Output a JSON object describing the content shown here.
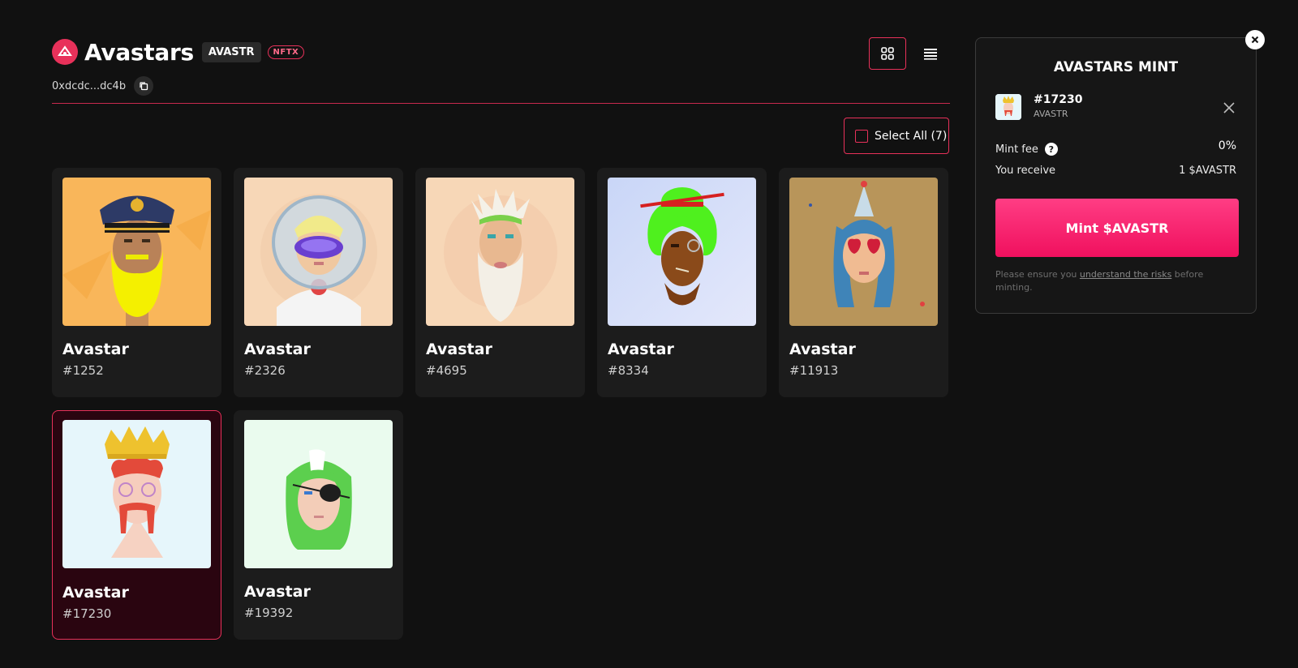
{
  "collection": {
    "title": "Avastars",
    "symbol_badge": "AVASTR",
    "tag_badge": "NFTX",
    "address": "0xdcdc...dc4b"
  },
  "toolbar": {
    "select_all_label": "Select All (7)"
  },
  "cards": [
    {
      "name": "Avastar",
      "number": "#1252"
    },
    {
      "name": "Avastar",
      "number": "#2326"
    },
    {
      "name": "Avastar",
      "number": "#4695"
    },
    {
      "name": "Avastar",
      "number": "#8334"
    },
    {
      "name": "Avastar",
      "number": "#11913"
    },
    {
      "name": "Avastar",
      "number": "#17230",
      "selected": true
    },
    {
      "name": "Avastar",
      "number": "#19392"
    }
  ],
  "mint_panel": {
    "title": "AVASTARS MINT",
    "item": {
      "id": "#17230",
      "symbol": "AVASTR"
    },
    "fee_label": "Mint fee",
    "fee_value": "0%",
    "receive_label": "You receive",
    "receive_value": "1 $AVASTR",
    "mint_button": "Mint $AVASTR",
    "disclaimer_prefix": "Please ensure you ",
    "disclaimer_link": "understand the risks",
    "disclaimer_suffix": " before minting."
  },
  "colors": {
    "accent": "#e8315a",
    "background": "#111111",
    "card": "#1c1c1c",
    "mint_button": "#ff2e78"
  },
  "icons": [
    "avastars-logo-icon",
    "copy-icon",
    "grid-view-icon",
    "list-view-icon",
    "checkbox-icon",
    "close-circle-icon",
    "close-icon",
    "help-icon"
  ]
}
